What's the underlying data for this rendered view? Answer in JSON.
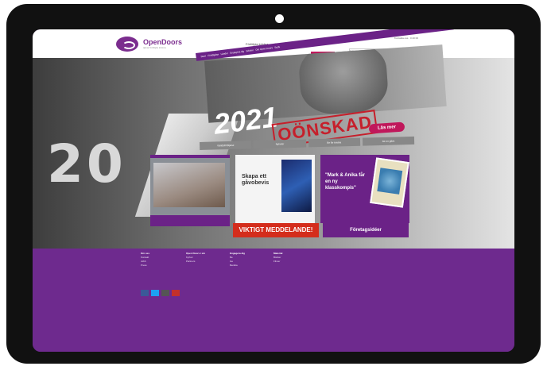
{
  "site": {
    "logo_name": "OpenDoors",
    "logo_tagline": "tjänar förföljda kristna",
    "top_links": [
      "Förföljda kristna",
      "Engagera dig"
    ],
    "top_right": "Kontakta oss · 0 20 00",
    "search_placeholder": "Sök",
    "donate_label": "Ge en gåva"
  },
  "nav": {
    "items": [
      "Start",
      "Förföljelse",
      "Länder",
      "Engagera dig",
      "Böcker",
      "Om Open Doors",
      "Butik"
    ]
  },
  "hero": {
    "big_left": "20",
    "year": "2021",
    "stamp": "OÖNSKAD",
    "read_more": "Läs mer"
  },
  "tabs": [
    "Världsförföljelse",
    "Nyheter",
    "Be för kristna",
    "Ge en gåva"
  ],
  "tiles": {
    "gift_text": "Skapa ett gåvobevis",
    "book_text": "\"Mark & Anika får en ny klasskompis\""
  },
  "ribbons": {
    "red": "VIKTIGT MEDDELANDE!",
    "purple": "Företagsidéer"
  },
  "footer": {
    "columns": [
      {
        "heading": "Om oss",
        "items": [
          "Kontakt",
          "Jobb",
          "Press"
        ]
      },
      {
        "heading": "Open Doors i sin",
        "items": [
          "Kyrkor",
          "Partners"
        ]
      },
      {
        "heading": "Engagera dig",
        "items": [
          "Be",
          "Ge",
          "Berätta"
        ]
      },
      {
        "heading": "Material",
        "items": [
          "Böcker",
          "Filmer"
        ]
      }
    ]
  },
  "colors": {
    "brand_purple": "#6b2287",
    "accent_red": "#d42d1c",
    "bezel": "#111111"
  }
}
